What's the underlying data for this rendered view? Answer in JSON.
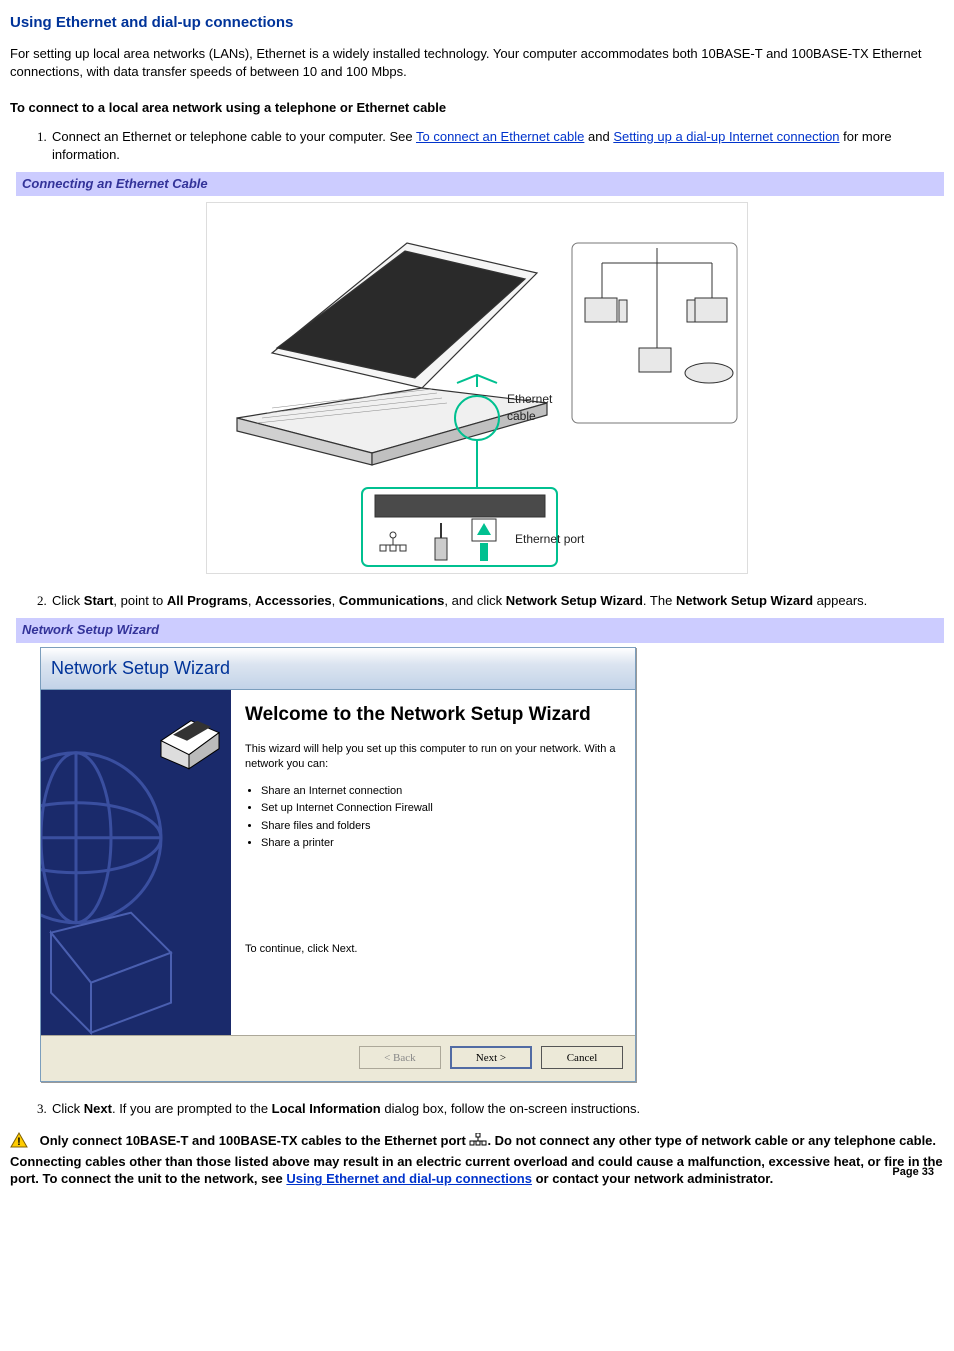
{
  "heading": "Using Ethernet and dial-up connections",
  "intro": "For setting up local area networks (LANs), Ethernet is a widely installed technology. Your computer accommodates both 10BASE-T and 100BASE-TX Ethernet connections, with data transfer speeds of between 10 and 100 Mbps.",
  "subhead": "To connect to a local area network using a telephone or Ethernet cable",
  "step1": {
    "pre": "Connect an Ethernet or telephone cable to your computer. See ",
    "link1": "To connect an Ethernet cable",
    "mid": " and ",
    "link2": "Setting up a dial-up Internet connection",
    "post": " for more information."
  },
  "bar1": "Connecting an Ethernet Cable",
  "fig1": {
    "label_cable": "Ethernet\ncable",
    "label_port": "Ethernet port"
  },
  "step2": {
    "pre": "Click ",
    "b1": "Start",
    "t1": ", point to ",
    "b2": "All Programs",
    "t2": ", ",
    "b3": "Accessories",
    "t3": ", ",
    "b4": "Communications",
    "t4": ", and click ",
    "b5": "Network Setup Wizard",
    "t5": ". The ",
    "b6": "Network Setup Wizard",
    "t6": " appears."
  },
  "bar2": "Network Setup Wizard",
  "dialog": {
    "title": "Network Setup Wizard",
    "heading": "Welcome to the Network Setup Wizard",
    "desc": "This wizard will help you set up this computer to run on your network. With a network you can:",
    "items": [
      "Share an Internet connection",
      "Set up Internet Connection Firewall",
      "Share files and folders",
      "Share a printer"
    ],
    "continue": "To continue, click Next.",
    "back": "< Back",
    "next": "Next >",
    "cancel": "Cancel"
  },
  "step3": {
    "pre": "Click ",
    "b1": "Next",
    "t1": ". If you are prompted to the ",
    "b2": "Local Information",
    "t2": " dialog box, follow the on-screen instructions."
  },
  "warning": {
    "pre": "Only connect 10BASE-T and 100BASE-TX cables to the Ethernet port ",
    "post": ". Do not connect any other type of network cable or any telephone cable. Connecting cables other than those listed above may result in an electric current overload and could cause a malfunction, excessive heat, or fire in the port. To connect the unit to the network, see ",
    "link": "Using Ethernet and dial-up connections",
    "post2": " or contact your network administrator."
  },
  "page": "Page 33"
}
